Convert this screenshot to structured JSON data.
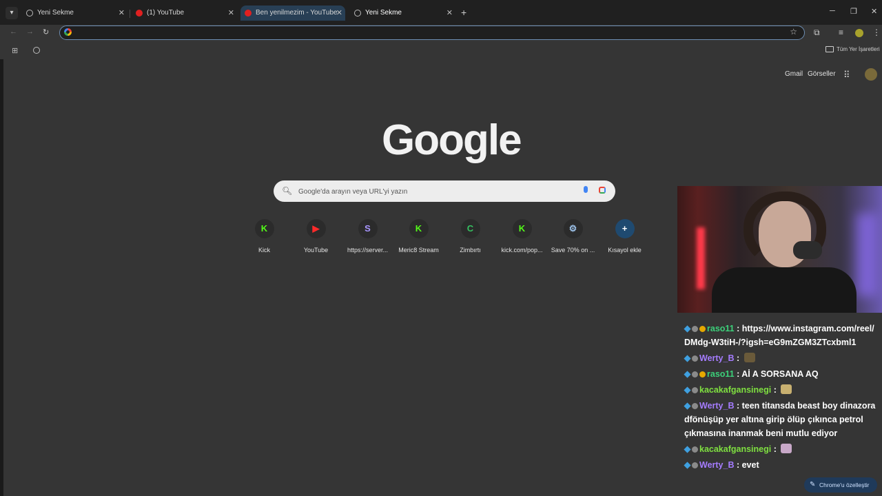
{
  "tabs": [
    {
      "title": "Yeni Sekme",
      "favicon": "globe-icon"
    },
    {
      "title": "(1) YouTube",
      "favicon": "youtube-icon"
    },
    {
      "title": "Ben yenilmezim - YouTube",
      "favicon": "youtube-icon"
    },
    {
      "title": "Yeni Sekme",
      "favicon": "globe-icon"
    }
  ],
  "omnibox": {
    "value": ""
  },
  "bookmarks": {
    "all_label": "Tüm Yer İşaretleri"
  },
  "header": {
    "gmail": "Gmail",
    "images": "Görseller"
  },
  "logo": "Google",
  "search": {
    "placeholder": "Google'da arayın veya URL'yi yazın"
  },
  "shortcuts": [
    {
      "label": "Kick",
      "glyph": "K",
      "color": "#53fc18"
    },
    {
      "label": "YouTube",
      "glyph": "▶",
      "color": "#ff2a2a"
    },
    {
      "label": "https://server...",
      "glyph": "S",
      "color": "#a896ff"
    },
    {
      "label": "Meric8 Stream",
      "glyph": "K",
      "color": "#53fc18"
    },
    {
      "label": "Zimbırtı",
      "glyph": "C",
      "color": "#36c060"
    },
    {
      "label": "kick.com/pop...",
      "glyph": "K",
      "color": "#53fc18"
    },
    {
      "label": "Save 70% on ...",
      "glyph": "⚙",
      "color": "#9bc0e8"
    },
    {
      "label": "Kısayol ekle",
      "glyph": "+",
      "color": "#ffffff"
    }
  ],
  "chat": [
    {
      "user": "raso11",
      "sep": " : ",
      "text": "https://www.instagram.com/reel/DMdg-W3tiH-/?igsh=eG9mZGM3ZTcxbml1",
      "color": "green"
    },
    {
      "user": "Werty_B",
      "sep": " : ",
      "text": "",
      "color": "purple",
      "emote": "em1"
    },
    {
      "user": "raso11",
      "sep": " : ",
      "text": "Aİ A SORSANA AQ",
      "color": "green"
    },
    {
      "user": "kacakafgansinegi",
      "sep": " : ",
      "text": "",
      "color": "lime",
      "emote": "em2"
    },
    {
      "user": "Werty_B",
      "sep": " : ",
      "text": "teen titansda beast boy dinazora dfönüşüp yer altına girip ölüp çıkınca petrol çıkmasına inanmak beni mutlu ediyor",
      "color": "purple"
    },
    {
      "user": "kacakafgansinegi",
      "sep": " : ",
      "text": "",
      "color": "lime",
      "emote": "em3"
    },
    {
      "user": "Werty_B",
      "sep": " : ",
      "text": "evet",
      "color": "purple"
    }
  ],
  "customize_label": "Chrome'u özelleştir"
}
